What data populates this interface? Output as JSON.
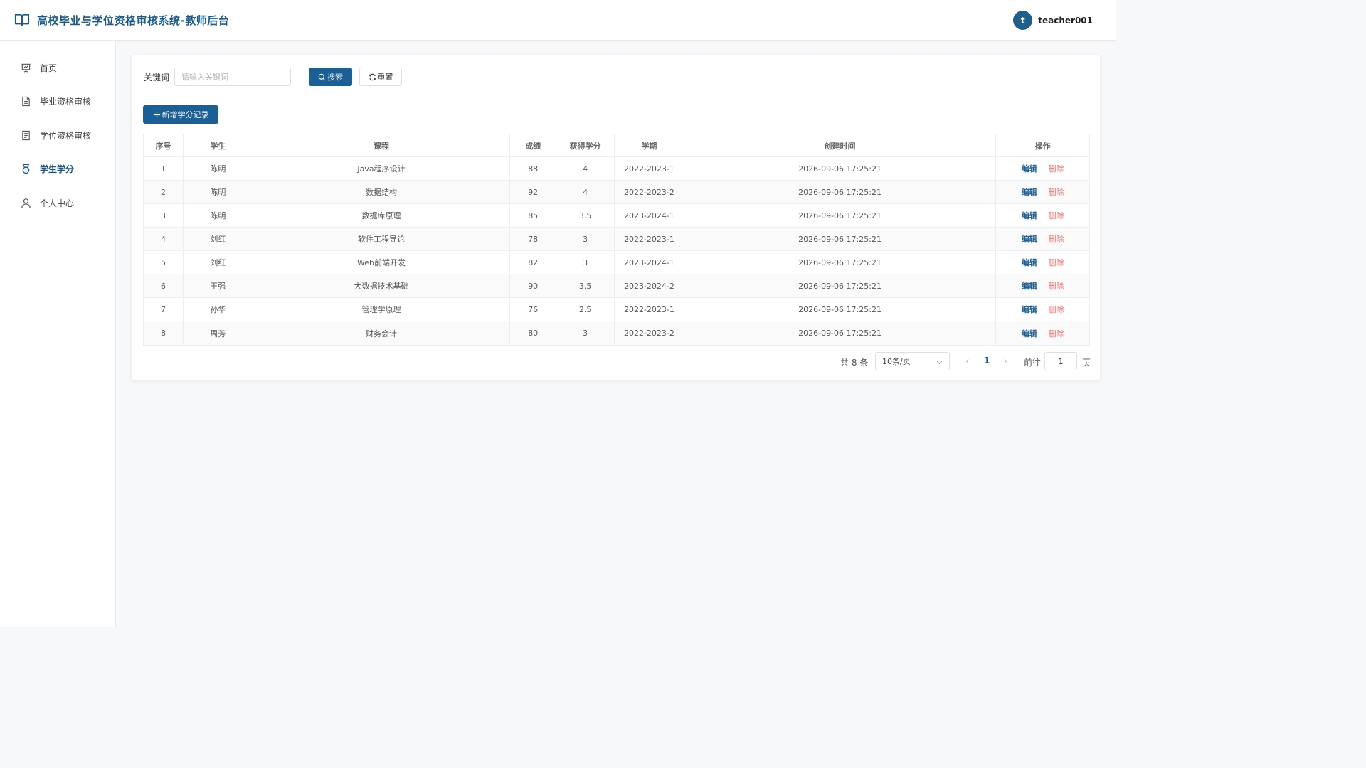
{
  "header": {
    "title": "高校毕业与学位资格审核系统-教师后台",
    "avatar_letter": "t",
    "username": "teacher001"
  },
  "sidebar": {
    "items": [
      {
        "label": "首页",
        "icon": "presentation-icon"
      },
      {
        "label": "毕业资格审核",
        "icon": "document-icon"
      },
      {
        "label": "学位资格审核",
        "icon": "document-list-icon"
      },
      {
        "label": "学生学分",
        "icon": "medal-icon",
        "active": true
      },
      {
        "label": "个人中心",
        "icon": "user-icon"
      }
    ]
  },
  "search": {
    "label": "关键词",
    "placeholder": "请输入关键词",
    "value": "",
    "search_label": "搜索",
    "reset_label": "重置"
  },
  "toolbar": {
    "add_label": "新增学分记录"
  },
  "table": {
    "columns": [
      "序号",
      "学生",
      "课程",
      "成绩",
      "获得学分",
      "学期",
      "创建时间",
      "操作"
    ],
    "rows": [
      {
        "no": "1",
        "student": "陈明",
        "course": "Java程序设计",
        "score": "88",
        "credit": "4",
        "term": "2022-2023-1",
        "created": "2026-09-06 17:25:21"
      },
      {
        "no": "2",
        "student": "陈明",
        "course": "数据结构",
        "score": "92",
        "credit": "4",
        "term": "2022-2023-2",
        "created": "2026-09-06 17:25:21"
      },
      {
        "no": "3",
        "student": "陈明",
        "course": "数据库原理",
        "score": "85",
        "credit": "3.5",
        "term": "2023-2024-1",
        "created": "2026-09-06 17:25:21"
      },
      {
        "no": "4",
        "student": "刘红",
        "course": "软件工程导论",
        "score": "78",
        "credit": "3",
        "term": "2022-2023-1",
        "created": "2026-09-06 17:25:21"
      },
      {
        "no": "5",
        "student": "刘红",
        "course": "Web前端开发",
        "score": "82",
        "credit": "3",
        "term": "2023-2024-1",
        "created": "2026-09-06 17:25:21"
      },
      {
        "no": "6",
        "student": "王强",
        "course": "大数据技术基础",
        "score": "90",
        "credit": "3.5",
        "term": "2023-2024-2",
        "created": "2026-09-06 17:25:21"
      },
      {
        "no": "7",
        "student": "孙华",
        "course": "管理学原理",
        "score": "76",
        "credit": "2.5",
        "term": "2022-2023-1",
        "created": "2026-09-06 17:25:21"
      },
      {
        "no": "8",
        "student": "周芳",
        "course": "财务会计",
        "score": "80",
        "credit": "3",
        "term": "2022-2023-2",
        "created": "2026-09-06 17:25:21"
      }
    ],
    "edit_label": "编辑",
    "delete_label": "删除"
  },
  "pagination": {
    "total_label": "共 8 条",
    "page_size": "10条/页",
    "current_page": "1",
    "goto_label": "前往",
    "goto_value": "1",
    "page_suffix": "页"
  },
  "colors": {
    "primary": "#1a5f95",
    "danger": "#f56c6c",
    "brand_text": "#1a5a8a"
  }
}
